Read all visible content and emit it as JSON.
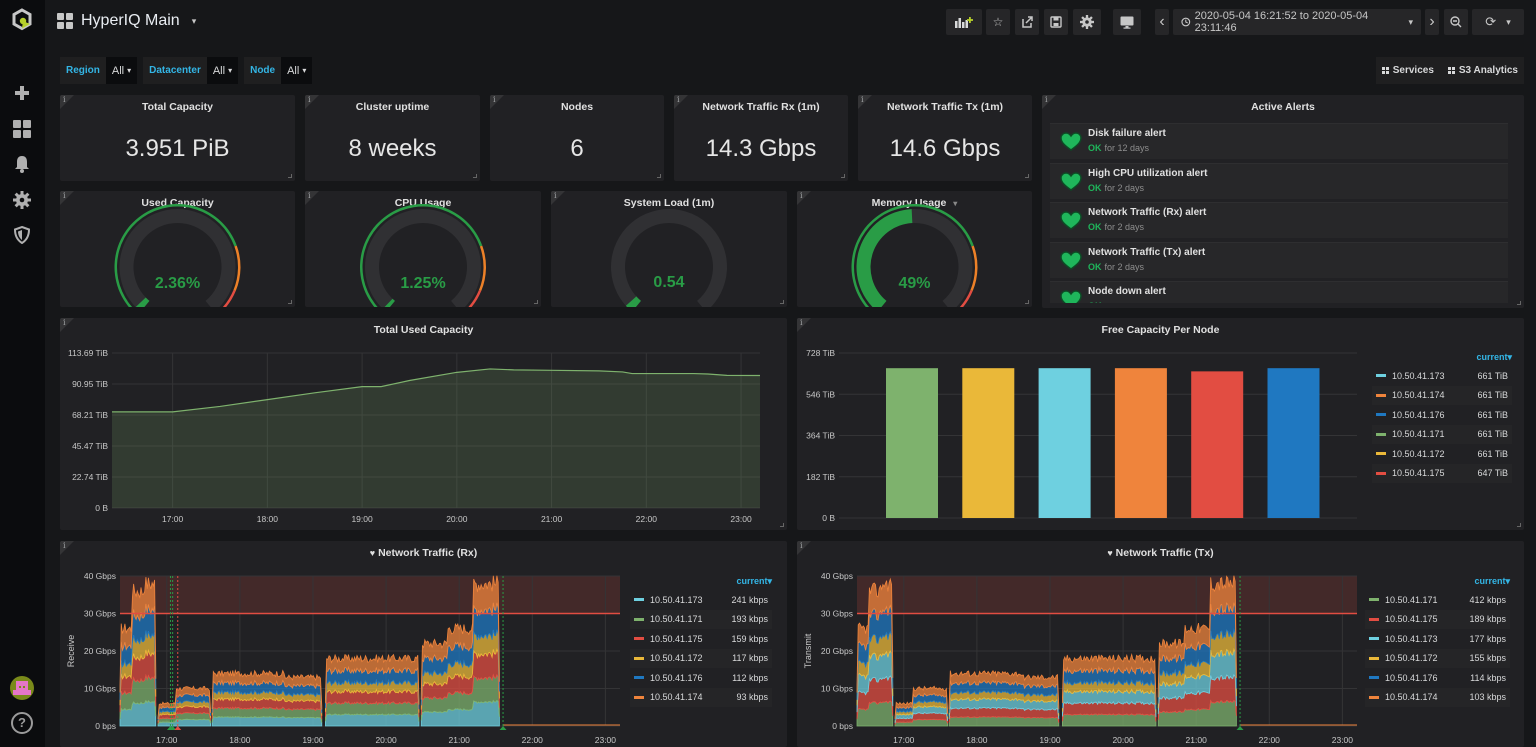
{
  "app": {
    "title": "HyperIQ Main"
  },
  "sidebar": {
    "items": [
      {
        "name": "create",
        "icon": "plus-icon"
      },
      {
        "name": "dashboards",
        "icon": "dashboards-grid-icon"
      },
      {
        "name": "alerting",
        "icon": "bell-icon"
      },
      {
        "name": "configuration",
        "icon": "gear-icon"
      },
      {
        "name": "server-admin",
        "icon": "shield-icon"
      }
    ],
    "help_label": "?"
  },
  "navbar": {
    "buttons": [
      {
        "name": "add-panel",
        "icon": "add-panel-icon"
      },
      {
        "name": "star",
        "icon": "star-icon",
        "glyph": "☆"
      },
      {
        "name": "share",
        "icon": "share-icon",
        "glyph": "⇱"
      },
      {
        "name": "save",
        "icon": "save-icon",
        "glyph": "🖫"
      },
      {
        "name": "settings",
        "icon": "gear-icon",
        "glyph": "✹"
      },
      {
        "name": "cycle-view-mode",
        "icon": "monitor-icon"
      }
    ],
    "time_range": "2020-05-04 16:21:52 to 2020-05-04 23:11:46",
    "time_back_glyph": "‹",
    "time_forward_glyph": "›",
    "zoom_out_glyph": "⊖",
    "refresh_glyph": "⟳",
    "refresh_caret": "▾"
  },
  "variables": [
    {
      "label": "Region",
      "value": "All"
    },
    {
      "label": "Datacenter",
      "value": "All"
    },
    {
      "label": "Node",
      "value": "All"
    }
  ],
  "dashboard_links": [
    {
      "label": "Services"
    },
    {
      "label": "S3 Analytics"
    }
  ],
  "stats": [
    {
      "title": "Total Capacity",
      "value": "3.951 PiB"
    },
    {
      "title": "Cluster uptime",
      "value": "8 weeks"
    },
    {
      "title": "Nodes",
      "value": "6"
    },
    {
      "title": "Network Traffic Rx (1m)",
      "value": "14.3 Gbps"
    },
    {
      "title": "Network Traffic Tx (1m)",
      "value": "14.6 Gbps"
    }
  ],
  "gauges": [
    {
      "title": "Used Capacity",
      "value": "2.36%",
      "fraction": 0.0236,
      "thresholds": true
    },
    {
      "title": "CPU Usage",
      "value": "1.25%",
      "fraction": 0.0125,
      "thresholds": true
    },
    {
      "title": "System Load  (1m)",
      "value": "0.54",
      "fraction": 0.03,
      "thresholds": false
    },
    {
      "title": "Memory Usage",
      "value": "49%",
      "fraction": 0.49,
      "thresholds": true,
      "has_menu": true
    }
  ],
  "alerts": {
    "title": "Active Alerts",
    "items": [
      {
        "name": "Disk failure alert",
        "state": "OK",
        "duration": "for 12 days"
      },
      {
        "name": "High CPU utilization alert",
        "state": "OK",
        "duration": "for 2 days"
      },
      {
        "name": "Network Traffic (Rx) alert",
        "state": "OK",
        "duration": "for 2 days"
      },
      {
        "name": "Network Traffic (Tx) alert",
        "state": "OK",
        "duration": "for 2 days"
      },
      {
        "name": "Node down alert",
        "state": "OK",
        "duration": ""
      }
    ]
  },
  "colors": {
    "green": "#7eb26d",
    "yellow": "#eab839",
    "cyan": "#6ed0e0",
    "orange": "#ef843c",
    "red": "#e24d42",
    "blue": "#1f78c1",
    "ok_green": "#299c46",
    "threshold_red": "#e24d42",
    "accent": "#33b5e5"
  },
  "chart_data": [
    {
      "id": "total-used-capacity",
      "type": "area",
      "title": "Total Used Capacity",
      "xlabel": "",
      "ylabel": "",
      "x_ticks": [
        "17:00",
        "18:00",
        "19:00",
        "20:00",
        "21:00",
        "22:00",
        "23:00"
      ],
      "y_ticks": [
        "0 B",
        "22.74 TiB",
        "45.47 TiB",
        "68.21 TiB",
        "90.95 TiB",
        "113.69 TiB"
      ],
      "ylim": [
        0,
        113.69
      ],
      "y_unit": "TiB",
      "x_range_hours": [
        16.36,
        23.2
      ],
      "series": [
        {
          "name": "Total Used Capacity",
          "color": "#7eb26d",
          "x": [
            16.36,
            17.0,
            17.5,
            18.0,
            18.5,
            19.0,
            19.2,
            19.5,
            20.0,
            20.35,
            20.6,
            21.0,
            21.5,
            21.75,
            21.85,
            22.0,
            22.5,
            22.65,
            22.85,
            23.2
          ],
          "values": [
            70.5,
            70.5,
            74.5,
            79.5,
            84.5,
            89.0,
            89.0,
            93.5,
            99.5,
            102.0,
            101.3,
            101.0,
            100.6,
            99.8,
            98.6,
            98.6,
            98.6,
            98.3,
            97.3,
            97.2
          ]
        }
      ],
      "grid": true
    },
    {
      "id": "free-capacity-per-node",
      "type": "bar",
      "title": "Free Capacity Per Node",
      "y_ticks": [
        "0 B",
        "182 TiB",
        "364 TiB",
        "546 TiB",
        "728 TiB"
      ],
      "ylim": [
        0,
        728
      ],
      "y_unit": "TiB",
      "categories": [
        "10.50.41.171",
        "10.50.41.172",
        "10.50.41.173",
        "10.50.41.174",
        "10.50.41.175",
        "10.50.41.176"
      ],
      "values": [
        661,
        661,
        661,
        661,
        647,
        661
      ],
      "bar_colors": [
        "#7eb26d",
        "#eab839",
        "#6ed0e0",
        "#ef843c",
        "#e24d42",
        "#1f78c1"
      ],
      "legend_header": "current▾",
      "legend_placement": "right",
      "legend": [
        {
          "name": "10.50.41.173",
          "color": "#6ed0e0",
          "current": "661 TiB"
        },
        {
          "name": "10.50.41.174",
          "color": "#ef843c",
          "current": "661 TiB"
        },
        {
          "name": "10.50.41.176",
          "color": "#1f78c1",
          "current": "661 TiB"
        },
        {
          "name": "10.50.41.171",
          "color": "#7eb26d",
          "current": "661 TiB"
        },
        {
          "name": "10.50.41.172",
          "color": "#eab839",
          "current": "661 TiB"
        },
        {
          "name": "10.50.41.175",
          "color": "#e24d42",
          "current": "647 TiB"
        }
      ]
    },
    {
      "id": "network-traffic-rx",
      "type": "area",
      "stacked": true,
      "title": "Network Traffic (Rx)",
      "ylabel": "Receive",
      "y_ticks": [
        "0 bps",
        "10 Gbps",
        "20 Gbps",
        "30 Gbps",
        "40 Gbps"
      ],
      "ylim": [
        0,
        40
      ],
      "y_unit": "Gbps",
      "threshold": 30,
      "x_ticks": [
        "17:00",
        "18:00",
        "19:00",
        "20:00",
        "21:00",
        "22:00",
        "23:00"
      ],
      "x_range_hours": [
        16.36,
        23.2
      ],
      "stack_order": [
        "10.50.41.173",
        "10.50.41.171",
        "10.50.41.175",
        "10.50.41.172",
        "10.50.41.176",
        "10.50.41.174"
      ],
      "segments": [
        {
          "start": 16.36,
          "end": 16.85,
          "total": [
            26,
            36,
            38
          ]
        },
        {
          "start": 16.88,
          "end": 17.6,
          "total": [
            6,
            10,
            10
          ]
        },
        {
          "start": 17.62,
          "end": 19.12,
          "total": [
            14,
            14,
            13
          ]
        },
        {
          "start": 19.17,
          "end": 20.45,
          "total": [
            18,
            18,
            18
          ]
        },
        {
          "start": 20.48,
          "end": 21.55,
          "total": [
            22,
            26,
            38
          ]
        }
      ],
      "legend_header": "current▾",
      "legend_placement": "right",
      "legend": [
        {
          "name": "10.50.41.173",
          "color": "#6ed0e0",
          "current": "241 kbps"
        },
        {
          "name": "10.50.41.171",
          "color": "#7eb26d",
          "current": "193 kbps"
        },
        {
          "name": "10.50.41.175",
          "color": "#e24d42",
          "current": "159 kbps"
        },
        {
          "name": "10.50.41.172",
          "color": "#eab839",
          "current": "117 kbps"
        },
        {
          "name": "10.50.41.176",
          "color": "#1f78c1",
          "current": "112 kbps"
        },
        {
          "name": "10.50.41.174",
          "color": "#ef843c",
          "current": "93 kbps"
        }
      ]
    },
    {
      "id": "network-traffic-tx",
      "type": "area",
      "stacked": true,
      "title": "Network Traffic (Tx)",
      "ylabel": "Transmit",
      "y_ticks": [
        "0 bps",
        "10 Gbps",
        "20 Gbps",
        "30 Gbps",
        "40 Gbps"
      ],
      "ylim": [
        0,
        40
      ],
      "y_unit": "Gbps",
      "threshold": 30,
      "x_ticks": [
        "17:00",
        "18:00",
        "19:00",
        "20:00",
        "21:00",
        "22:00",
        "23:00"
      ],
      "x_range_hours": [
        16.36,
        23.2
      ],
      "stack_order": [
        "10.50.41.171",
        "10.50.41.175",
        "10.50.41.173",
        "10.50.41.172",
        "10.50.41.176",
        "10.50.41.174"
      ],
      "segments": [
        {
          "start": 16.36,
          "end": 16.85,
          "total": [
            26,
            36,
            38
          ]
        },
        {
          "start": 16.88,
          "end": 17.6,
          "total": [
            6,
            10,
            10
          ]
        },
        {
          "start": 17.62,
          "end": 19.12,
          "total": [
            14,
            14,
            13
          ]
        },
        {
          "start": 19.17,
          "end": 20.45,
          "total": [
            18,
            18,
            18
          ]
        },
        {
          "start": 20.48,
          "end": 21.55,
          "total": [
            22,
            26,
            38
          ]
        }
      ],
      "legend_header": "current▾",
      "legend_placement": "right",
      "legend": [
        {
          "name": "10.50.41.171",
          "color": "#7eb26d",
          "current": "412 kbps"
        },
        {
          "name": "10.50.41.175",
          "color": "#e24d42",
          "current": "189 kbps"
        },
        {
          "name": "10.50.41.173",
          "color": "#6ed0e0",
          "current": "177 kbps"
        },
        {
          "name": "10.50.41.172",
          "color": "#eab839",
          "current": "155 kbps"
        },
        {
          "name": "10.50.41.176",
          "color": "#1f78c1",
          "current": "114 kbps"
        },
        {
          "name": "10.50.41.174",
          "color": "#ef843c",
          "current": "103 kbps"
        }
      ]
    }
  ]
}
